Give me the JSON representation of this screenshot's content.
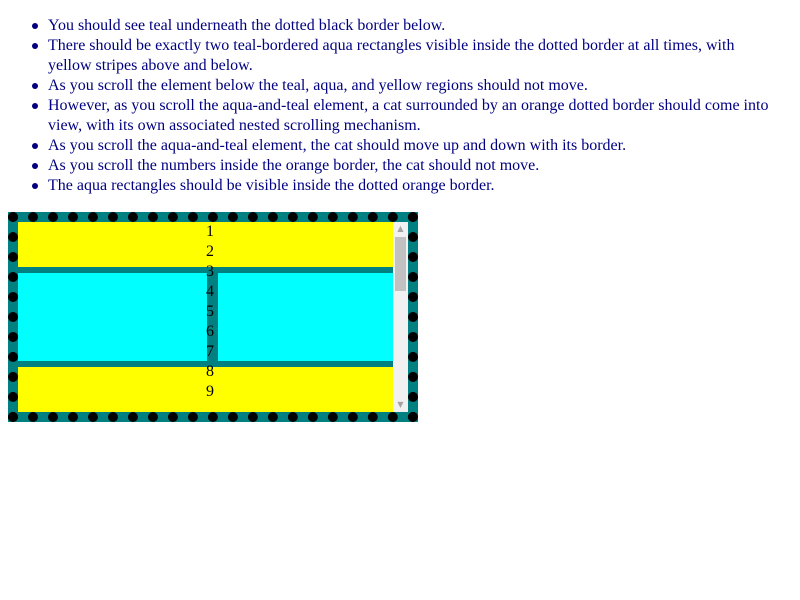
{
  "instructions": [
    "You should see teal underneath the dotted black border below.",
    "There should be exactly two teal-bordered aqua rectangles visible inside the dotted border at all times, with yellow stripes above and below.",
    "As you scroll the element below the teal, aqua, and yellow regions should not move.",
    "However, as you scroll the aqua-and-teal element, a cat surrounded by an orange dotted border should come into view, with its own associated nested scrolling mechanism.",
    "As you scroll the aqua-and-teal element, the cat should move up and down with its border.",
    "As you scroll the numbers inside the orange border, the cat should not move.",
    "The aqua rectangles should be visible inside the dotted orange border."
  ],
  "numbers": [
    "1",
    "2",
    "3",
    "4",
    "5",
    "6",
    "7",
    "8",
    "9"
  ],
  "scrollbar": {
    "up_icon": "triangle-up-icon",
    "down_icon": "triangle-down-icon",
    "up_glyph": "▲",
    "down_glyph": "▼"
  },
  "colors": {
    "teal": "#008080",
    "aqua": "#00ffff",
    "yellow": "#ffff00",
    "border": "#000000",
    "text": "#000080"
  }
}
